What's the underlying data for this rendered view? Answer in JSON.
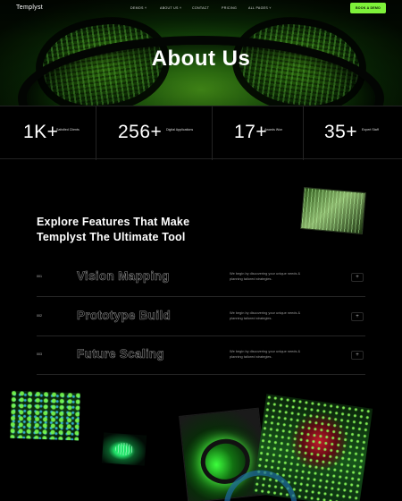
{
  "header": {
    "logo": "Templyst",
    "nav": [
      {
        "label": "DEMOS",
        "has_dropdown": true
      },
      {
        "label": "ABOUT US",
        "has_dropdown": true
      },
      {
        "label": "CONTACT",
        "has_dropdown": false
      },
      {
        "label": "PRICING",
        "has_dropdown": false
      },
      {
        "label": "ALL PAGES",
        "has_dropdown": true
      }
    ],
    "cta_label": "BOOK A DEMO"
  },
  "hero": {
    "title": "About Us"
  },
  "stats": [
    {
      "value": "1K+",
      "label": "Satisfied Clients"
    },
    {
      "value": "256+",
      "label": "Digital Applications"
    },
    {
      "value": "17+",
      "label": "Awards Won"
    },
    {
      "value": "35+",
      "label": "Expert Staff"
    }
  ],
  "features": {
    "headline_line1": "Explore Features That Make",
    "headline_line2": "Templyst The Ultimate Tool",
    "items": [
      {
        "number": "001",
        "title": "Vision Mapping",
        "description": "We begin by discovering your unique needs & planning tailored strategies.",
        "action": "+"
      },
      {
        "number": "002",
        "title": "Prototype Build",
        "description": "We begin by discovering your unique needs & planning tailored strategies.",
        "action": "+"
      },
      {
        "number": "003",
        "title": "Future Scaling",
        "description": "We begin by discovering your unique needs & planning tailored strategies.",
        "action": "+"
      }
    ]
  },
  "colors": {
    "accent": "#7ef23a",
    "background": "#000000",
    "outline_text": "#8a8a8a"
  },
  "icons": [
    "chevron-down-icon",
    "plus-icon"
  ]
}
